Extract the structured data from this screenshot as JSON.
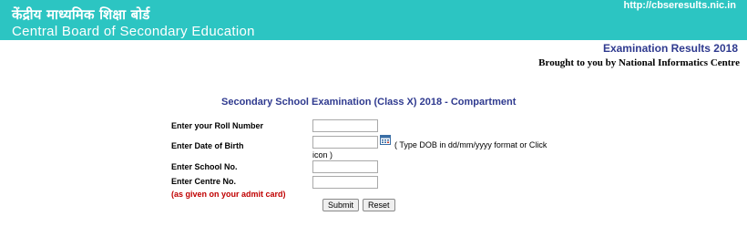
{
  "header": {
    "hindi_name": "केंद्रीय माध्यमिक शिक्षा बोर्ड",
    "english_name": "Central Board of Secondary Education",
    "url": "http://cbseresults.nic.in",
    "bg_color": "#2cc5c2"
  },
  "info": {
    "exam_results": "Examination Results 2018",
    "brought_by": "Brought to you by National Informatics Centre"
  },
  "form": {
    "title": "Secondary School Examination (Class X) 2018 - Compartment",
    "roll_label": "Enter your Roll Number",
    "roll_value": "",
    "dob_label": "Enter Date of Birth",
    "dob_value": "",
    "dob_hint_line1": "( Type DOB in dd/mm/yyyy format or Click",
    "dob_hint_line2": "icon )",
    "calendar_icon": "calendar-icon",
    "school_label": "Enter School No.",
    "school_value": "",
    "centre_label": "Enter Centre No.",
    "centre_value": "",
    "admit_note": "(as given on your admit card)",
    "submit_label": "Submit",
    "reset_label": "Reset"
  }
}
